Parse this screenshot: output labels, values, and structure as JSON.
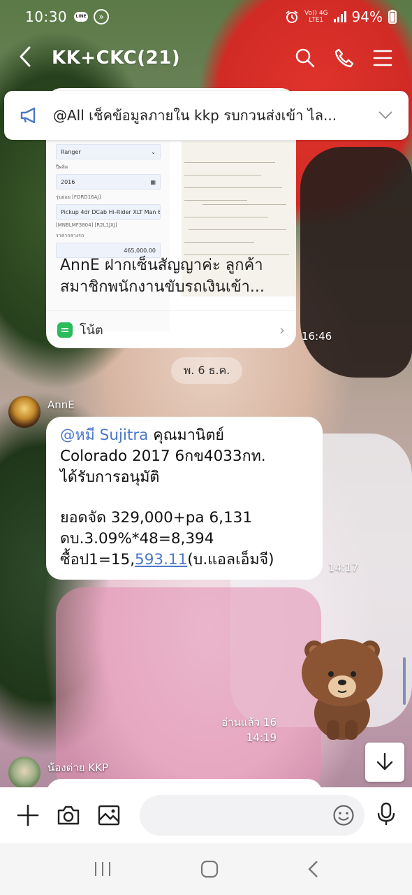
{
  "status_bar": {
    "time": "10:30",
    "line_badge": "LINE",
    "network_top": "Vo)) 4G",
    "network_bottom": "LTE1",
    "battery": "94%"
  },
  "header": {
    "title": "KK+CKC(21)"
  },
  "announcement": {
    "text": "@All  เช็คข้อมูลภายใน kkp รบกวนส่งเข้า ไล..."
  },
  "note_message": {
    "form": {
      "model": "Ranger",
      "year_label": "ปีผลิต",
      "year": "2016",
      "code_label": "รุ่นย่อย [FORD16AJ]",
      "variant": "Pickup 4dr DCab Hi-Rider XLT Man 6sp ...",
      "variant_code": "[MNBLMF3804] [R2L1JXJ]",
      "price_label": "ราคากลางรถ",
      "price": "465,000.00"
    },
    "caption_line1": "AnnE ฝากเซ็นสัญญาค่ะ ลูกค้า",
    "caption_line2": "สมาชิกพนักงานขับรถเงินเข้า...",
    "footer_label": "โน้ต",
    "time": "16:46"
  },
  "date_separator": "พ. 6 ธ.ค.",
  "message1": {
    "sender": "AnnE",
    "mention": "@หมี Sujitra",
    "line1_rest": " คุณมานิตย์",
    "line2": "Colorado 2017 6กข4033กท.",
    "line3": "ได้รับการอนุมัติ",
    "line4": "ยอดจัด 329,000+pa 6,131",
    "line5": "ดบ.3.09%*48=8,394",
    "line6_prefix": "ซื้อป1=15,",
    "line6_link": "593.11",
    "line6_suffix": "(บ.แอลเอ็มจี)",
    "time": "14:17"
  },
  "sticker_message": {
    "read_status": "อ่านแล้ว 16",
    "time": "14:19"
  },
  "message2": {
    "sender": "น้องต่าย KKP"
  },
  "colors": {
    "mention": "#4a78c8",
    "note_green": "#2bbb5b"
  }
}
